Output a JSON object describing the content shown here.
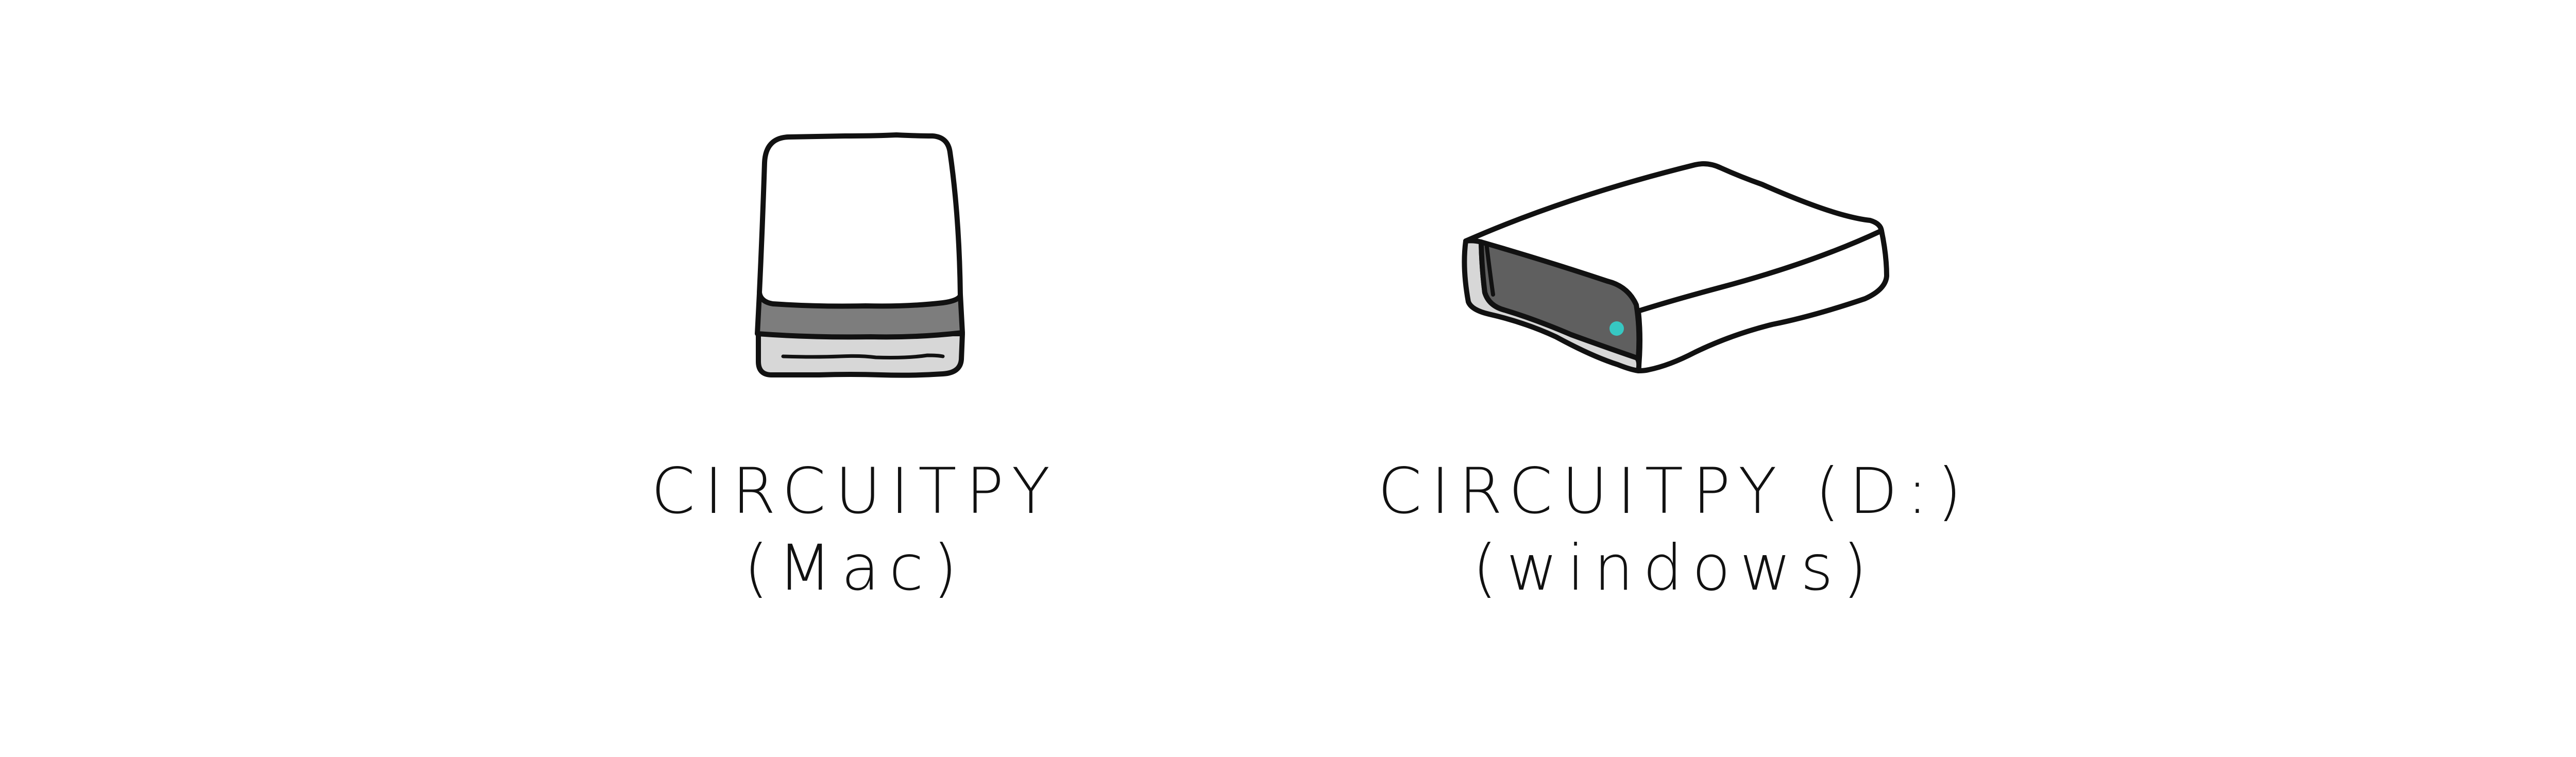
{
  "drives": {
    "mac": {
      "name": "CIRCUITPY",
      "platform": "(Mac)",
      "icon": "external-drive-icon"
    },
    "windows": {
      "name": "CIRCUITPY (D:)",
      "platform": "(windows)",
      "icon": "hard-disk-drive-icon"
    }
  },
  "colors": {
    "outline": "#111111",
    "body_fill": "#ffffff",
    "mid_gray": "#7d7d7d",
    "dark_gray": "#5f5f5f",
    "light_gray": "#d7d7d7",
    "status_light": "#37c7c2"
  }
}
